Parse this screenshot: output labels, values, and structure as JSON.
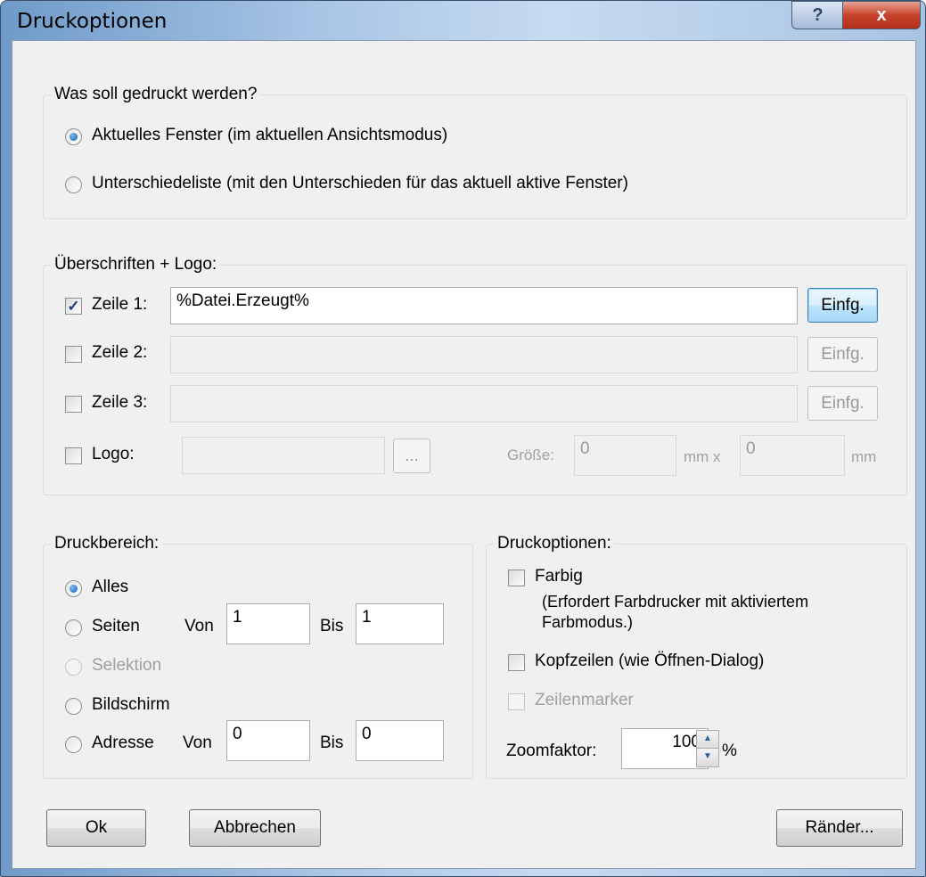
{
  "window": {
    "title": "Druckoptionen",
    "help_label": "?",
    "close_label": "x"
  },
  "print_what": {
    "title": "Was soll gedruckt werden?",
    "options": [
      {
        "label": "Aktuelles Fenster (im aktuellen Ansichtsmodus)",
        "selected": true
      },
      {
        "label": "Unterschiedeliste (mit den Unterschieden für das aktuell aktive Fenster)",
        "selected": false
      }
    ]
  },
  "headers": {
    "title": "Überschriften + Logo:",
    "rows": [
      {
        "label": "Zeile 1:",
        "checked": true,
        "value": "%Datei.Erzeugt%",
        "insert_label": "Einfg."
      },
      {
        "label": "Zeile 2:",
        "checked": false,
        "value": "",
        "insert_label": "Einfg."
      },
      {
        "label": "Zeile 3:",
        "checked": false,
        "value": "",
        "insert_label": "Einfg."
      }
    ],
    "logo": {
      "label": "Logo:",
      "checked": false,
      "browse_label": "...",
      "size_label": "Größe:",
      "width": "0",
      "width_unit": "mm x",
      "height": "0",
      "height_unit": "mm"
    }
  },
  "range": {
    "title": "Druckbereich:",
    "all": "Alles",
    "pages": "Seiten",
    "pages_from_label": "Von",
    "pages_from": "1",
    "pages_to_label": "Bis",
    "pages_to": "1",
    "selection": "Selektion",
    "screen": "Bildschirm",
    "address": "Adresse",
    "address_from_label": "Von",
    "address_from": "0",
    "address_to_label": "Bis",
    "address_to": "0"
  },
  "options": {
    "title": "Druckoptionen:",
    "color": "Farbig",
    "color_note_1": "(Erfordert Farbdrucker mit aktiviertem",
    "color_note_2": "Farbmodus.)",
    "headers_label": "Kopfzeilen (wie Öffnen-Dialog)",
    "line_markers": "Zeilenmarker",
    "zoom_label": "Zoomfaktor:",
    "zoom_value": "100",
    "zoom_unit": "%"
  },
  "buttons": {
    "ok": "Ok",
    "cancel": "Abbrechen",
    "margins": "Ränder..."
  }
}
